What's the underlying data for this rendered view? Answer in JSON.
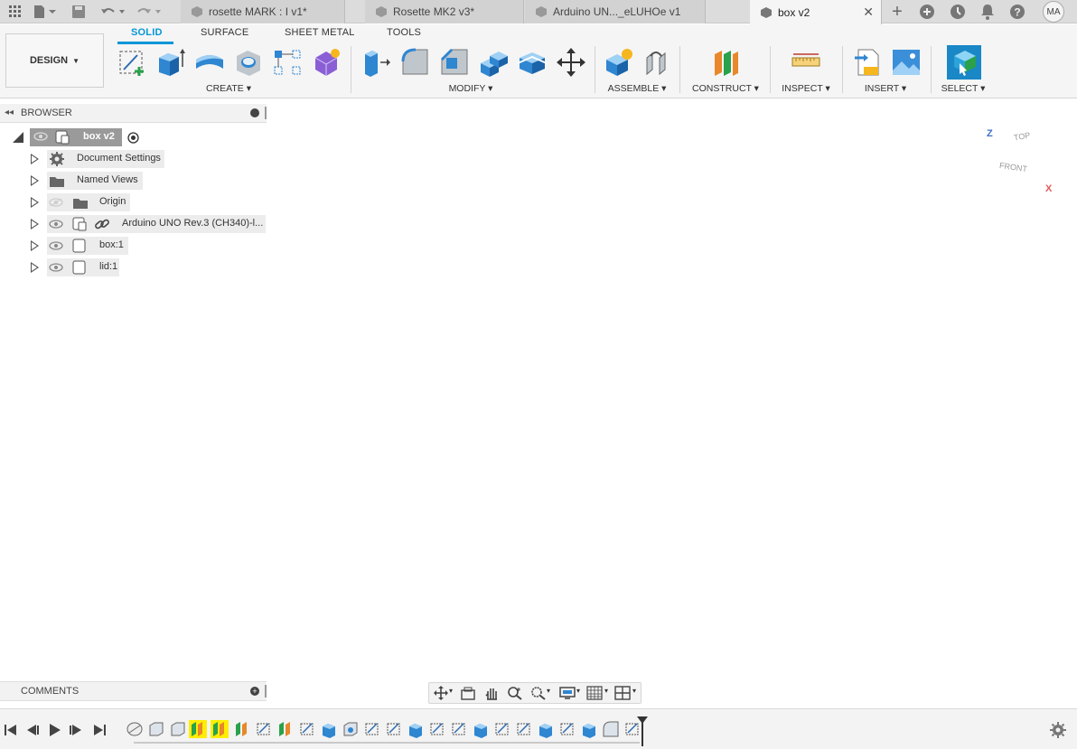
{
  "tabs": [
    {
      "label": "rosette MARK : I v1*",
      "active": false
    },
    {
      "label": "Rosette MK2 v3*",
      "active": false
    },
    {
      "label": "Arduino UN..._eLUHOe v1",
      "active": false
    },
    {
      "label": "box v2",
      "active": true
    }
  ],
  "user": {
    "initials": "MA"
  },
  "toolbar": {
    "workspace": "DESIGN",
    "workspace_tabs": [
      "SOLID",
      "SURFACE",
      "SHEET METAL",
      "TOOLS"
    ],
    "groups": {
      "create": "CREATE",
      "modify": "MODIFY",
      "assemble": "ASSEMBLE",
      "construct": "CONSTRUCT",
      "inspect": "INSPECT",
      "insert": "INSERT",
      "select": "SELECT"
    }
  },
  "browser": {
    "title": "BROWSER",
    "root": "box v2",
    "items": [
      {
        "label": "Document Settings",
        "icon": "gear-icon"
      },
      {
        "label": "Named Views",
        "icon": "folder-icon"
      },
      {
        "label": "Origin",
        "icon": "folder-icon"
      },
      {
        "label": "Arduino UNO Rev.3 (CH340)-l...",
        "icon": "component-link-icon"
      },
      {
        "label": "box:1",
        "icon": "component-icon"
      },
      {
        "label": "lid:1",
        "icon": "component-icon"
      }
    ]
  },
  "comments": {
    "title": "COMMENTS"
  },
  "viewcube": {
    "top": "TOP",
    "front": "FRONT",
    "axis_x": "X",
    "axis_z": "Z"
  },
  "colors": {
    "accent": "#0696d7",
    "box": "#7b7b78",
    "board": "#e3e7ea"
  }
}
